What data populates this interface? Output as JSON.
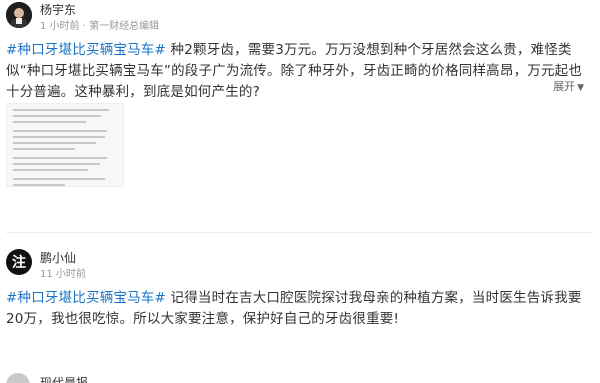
{
  "posts": [
    {
      "author": "杨宇东",
      "meta": "1 小时前 · 第一财经总编辑",
      "tag": "#种口牙堪比买辆宝马车#",
      "body": " 种2颗牙齿，需要3万元。万万没想到种个牙居然会这么贵，难怪类似“种口牙堪比买辆宝马车”的段子广为流传。除了种牙外，牙齿正畸的价格同样高昂，万元起也十分普遍。这种暴利，到底是如何产生的?",
      "expand_label": "展开"
    },
    {
      "author": "鹏小仙",
      "avatar_text": "注",
      "meta": "11 小时前",
      "tag": "#种口牙堪比买辆宝马车#",
      "body": " 记得当时在吉大口腔医院探讨我母亲的种植方案，当时医生告诉我要20万，我也很吃惊。所以大家要注意，保护好自己的牙齿很重要!"
    },
    {
      "author": "现代晨报"
    }
  ],
  "icons": {
    "expand": "chevron-down-icon"
  }
}
